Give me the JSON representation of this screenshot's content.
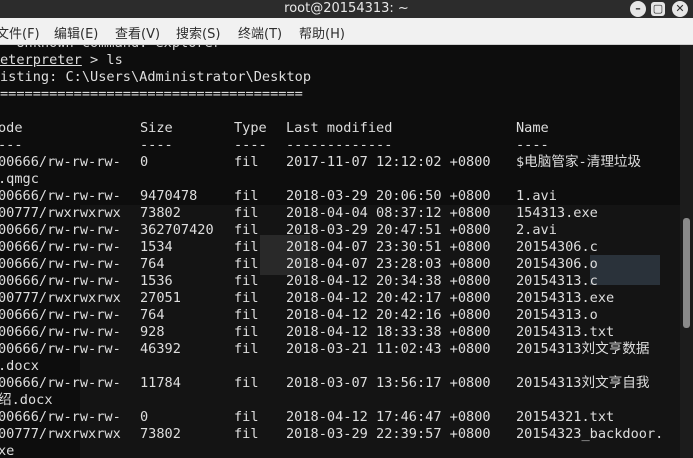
{
  "window": {
    "title": "root@20154313: ~"
  },
  "menu": [
    "文件(F)",
    "编辑(E)",
    "查看(V)",
    "搜索(S)",
    "终端(T)",
    "帮助(H)"
  ],
  "terminal": {
    "partial_top": "  Unknown command: explorer",
    "prompt": "eterpreter",
    "command": " > ls",
    "listing_line": "isting: C:\\Users\\Administrator\\Desktop",
    "separator": "=====================================",
    "headers": {
      "mode": "ode",
      "size": "Size",
      "type": "Type",
      "modified": "Last modified",
      "name": "Name"
    },
    "header_dashes": {
      "mode": "---",
      "size": "----",
      "type": "----",
      "modified": "-------------",
      "name": "----"
    },
    "rows": [
      {
        "mode": "00666/rw-rw-rw-",
        "size": "0",
        "type": "fil",
        "modified": "2017-11-07 12:12:02 +0800",
        "name": "$电脑管家-清理垃圾",
        "cont": ".qmgc"
      },
      {
        "mode": "00666/rw-rw-rw-",
        "size": "9470478",
        "type": "fil",
        "modified": "2018-03-29 20:06:50 +0800",
        "name": "1.avi",
        "cont": ""
      },
      {
        "mode": "00777/rwxrwxrwx",
        "size": "73802",
        "type": "fil",
        "modified": "2018-04-04 08:37:12 +0800",
        "name": "154313.exe",
        "cont": ""
      },
      {
        "mode": "00666/rw-rw-rw-",
        "size": "362707420",
        "type": "fil",
        "modified": "2018-03-29 20:47:51 +0800",
        "name": "2.avi",
        "cont": ""
      },
      {
        "mode": "00666/rw-rw-rw-",
        "size": "1534",
        "type": "fil",
        "modified": "2018-04-07 23:30:51 +0800",
        "name": "20154306.c",
        "cont": ""
      },
      {
        "mode": "00666/rw-rw-rw-",
        "size": "764",
        "type": "fil",
        "modified": "2018-04-07 23:28:03 +0800",
        "name": "20154306.o",
        "cont": ""
      },
      {
        "mode": "00666/rw-rw-rw-",
        "size": "1536",
        "type": "fil",
        "modified": "2018-04-12 20:34:38 +0800",
        "name": "20154313.c",
        "cont": ""
      },
      {
        "mode": "00777/rwxrwxrwx",
        "size": "27051",
        "type": "fil",
        "modified": "2018-04-12 20:42:17 +0800",
        "name": "20154313.exe",
        "cont": ""
      },
      {
        "mode": "00666/rw-rw-rw-",
        "size": "764",
        "type": "fil",
        "modified": "2018-04-12 20:42:16 +0800",
        "name": "20154313.o",
        "cont": ""
      },
      {
        "mode": "00666/rw-rw-rw-",
        "size": "928",
        "type": "fil",
        "modified": "2018-04-12 18:33:38 +0800",
        "name": "20154313.txt",
        "cont": ""
      },
      {
        "mode": "00666/rw-rw-rw-",
        "size": "46392",
        "type": "fil",
        "modified": "2018-03-21 11:02:43 +0800",
        "name": "20154313刘文亨数据",
        "cont": ".docx"
      },
      {
        "mode": "00666/rw-rw-rw-",
        "size": "11784",
        "type": "fil",
        "modified": "2018-03-07 13:56:17 +0800",
        "name": "20154313刘文亨自我",
        "cont": "绍.docx"
      },
      {
        "mode": "00666/rw-rw-rw-",
        "size": "0",
        "type": "fil",
        "modified": "2018-04-12 17:46:47 +0800",
        "name": "20154321.txt",
        "cont": ""
      },
      {
        "mode": "00777/rwxrwxrwx",
        "size": "73802",
        "type": "fil",
        "modified": "2018-03-29 22:39:57 +0800",
        "name": "20154323_backdoor.",
        "cont": "xe"
      }
    ]
  },
  "colors": {
    "titlebar": "#2c2c2c",
    "menubar": "#f1f1f1",
    "terminal_bg": "#0d0d0d",
    "text": "#dedede"
  }
}
